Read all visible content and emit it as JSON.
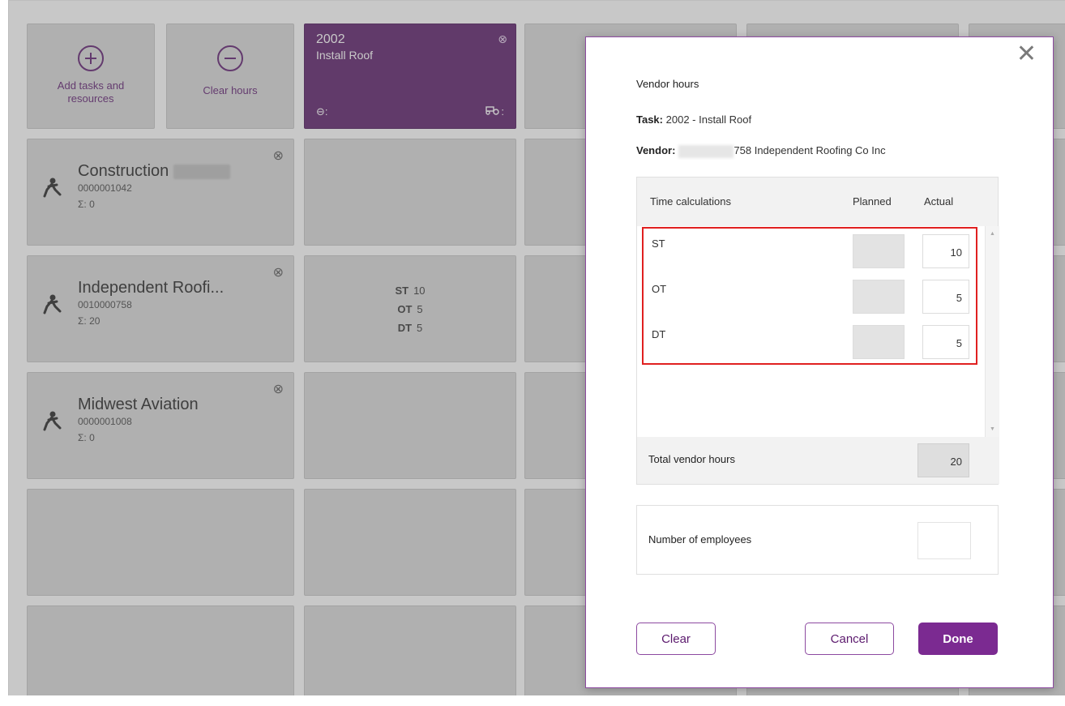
{
  "actions": {
    "add": {
      "label_line1": "Add tasks and",
      "label_line2": "resources"
    },
    "clear": {
      "label": "Clear hours"
    }
  },
  "task": {
    "number": "2002",
    "name": "Install Roof",
    "close_glyph": "⊗",
    "helmet_label": "⊖:",
    "equipment_label": ":"
  },
  "resources": [
    {
      "name": "Construction",
      "id": "0000001042",
      "sum": "Σ: 0"
    },
    {
      "name": "Independent Roofi...",
      "id": "0010000758",
      "sum": "Σ: 20"
    },
    {
      "name": "Midwest Aviation",
      "id": "0000001008",
      "sum": "Σ: 0"
    }
  ],
  "resource_close_glyph": "⊗",
  "hours_cell": {
    "st_label": "ST",
    "st_value": "10",
    "ot_label": "OT",
    "ot_value": "5",
    "dt_label": "DT",
    "dt_value": "5"
  },
  "modal": {
    "close_glyph": "✕",
    "title": "Vendor hours",
    "task_label": "Task:",
    "task_value": "2002 - Install Roof",
    "vendor_label": "Vendor:",
    "vendor_value": "758 Independent Roofing Co Inc",
    "table": {
      "col_time": "Time calculations",
      "col_planned": "Planned",
      "col_actual": "Actual",
      "rows": [
        {
          "label": "ST",
          "planned": "",
          "actual": "10"
        },
        {
          "label": "OT",
          "planned": "",
          "actual": "5"
        },
        {
          "label": "DT",
          "planned": "",
          "actual": "5"
        }
      ],
      "total_label": "Total vendor hours",
      "total_value": "20"
    },
    "employees_label": "Number of employees",
    "employees_value": "",
    "buttons": {
      "clear": "Clear",
      "cancel": "Cancel",
      "done": "Done"
    }
  },
  "colors": {
    "accent": "#7b2a91",
    "task_tile": "#5a1a68",
    "highlight": "#e02020"
  }
}
